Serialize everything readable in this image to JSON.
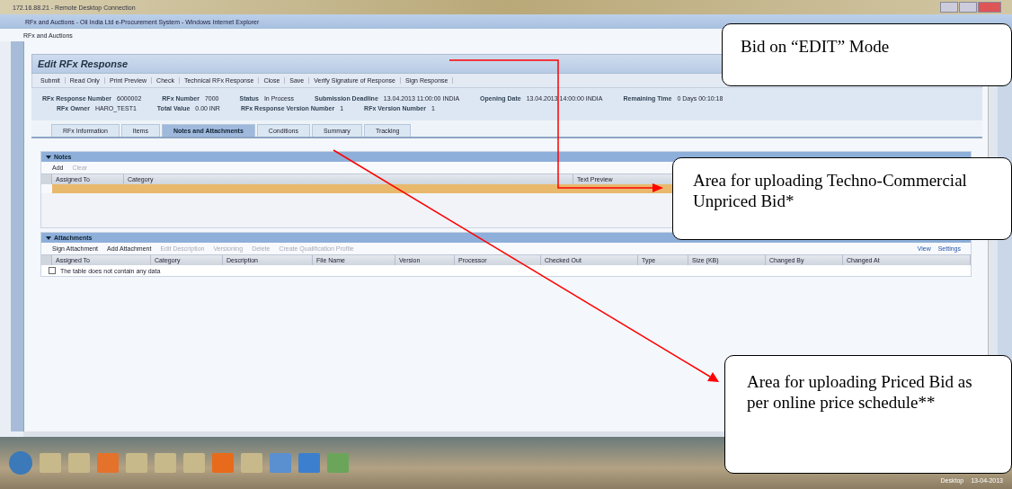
{
  "rdp_window": {
    "title": "172.16.88.21 - Remote Desktop Connection"
  },
  "browser": {
    "title": "RFx and Auctions - Oil India Ltd e-Procurement System - Windows Internet Explorer",
    "tab_title": "RFx and Auctions"
  },
  "page": {
    "heading": "Edit RFx Response",
    "toolbar": [
      {
        "label": "Submit"
      },
      {
        "label": "Read Only"
      },
      {
        "label": "Print Preview"
      },
      {
        "label": "Check"
      },
      {
        "label": "Technical RFx Response"
      },
      {
        "label": "Close"
      },
      {
        "label": "Save"
      },
      {
        "label": "Verify Signature of Response"
      },
      {
        "label": "Sign Response"
      }
    ],
    "info_rows": [
      [
        {
          "label": "RFx Response Number",
          "value": "6000002"
        },
        {
          "label": "RFx Number",
          "value": "7000"
        },
        {
          "label": "Status",
          "value": "In Process"
        },
        {
          "label": "Submission Deadline",
          "value": "13.04.2013 11:00:00 INDIA"
        },
        {
          "label": "Opening Date",
          "value": "13.04.2013 14:00:00 INDIA"
        },
        {
          "label": "Remaining Time",
          "value": "0 Days 00:10:18"
        }
      ],
      [
        {
          "label": "RFx Owner",
          "value": "HARO_TEST1"
        },
        {
          "label": "Total Value",
          "value": "0.00 INR"
        },
        {
          "label": "RFx Response Version Number",
          "value": "1"
        },
        {
          "label": "RFx Version Number",
          "value": "1"
        }
      ]
    ],
    "tabs": [
      {
        "label": "RFx Information",
        "selected": false
      },
      {
        "label": "Items",
        "selected": false
      },
      {
        "label": "Notes and Attachments",
        "selected": true
      },
      {
        "label": "Conditions",
        "selected": false
      },
      {
        "label": "Summary",
        "selected": false
      },
      {
        "label": "Tracking",
        "selected": false
      }
    ],
    "notes": {
      "title": "Notes",
      "actions": [
        {
          "label": "Add",
          "disabled": false
        },
        {
          "label": "Clear",
          "disabled": true
        }
      ],
      "columns": [
        "Assigned To",
        "Category",
        "Text Preview"
      ]
    },
    "attachments": {
      "title": "Attachments",
      "actions": [
        {
          "label": "Sign Attachment",
          "disabled": false
        },
        {
          "label": "Add Attachment",
          "disabled": false
        },
        {
          "label": "Edit Description",
          "disabled": true
        },
        {
          "label": "Versioning",
          "disabled": true
        },
        {
          "label": "Delete",
          "disabled": true
        },
        {
          "label": "Create Qualification Profile",
          "disabled": true
        }
      ],
      "links": [
        "View",
        "Settings"
      ],
      "columns": [
        "Assigned To",
        "Category",
        "Description",
        "File Name",
        "Version",
        "Processor",
        "Checked Out",
        "Type",
        "Size (KB)",
        "Changed By",
        "Changed At"
      ],
      "empty_text": "The table does not contain any data"
    }
  },
  "taskbar": {
    "language": "Desktop",
    "date": "13-04-2013"
  },
  "callouts": [
    {
      "text": "Bid on “EDIT” Mode"
    },
    {
      "text": "Area for uploading Techno-Commercial Unpriced Bid*"
    },
    {
      "text": "Area for uploading Priced Bid as per online price schedule**"
    }
  ]
}
